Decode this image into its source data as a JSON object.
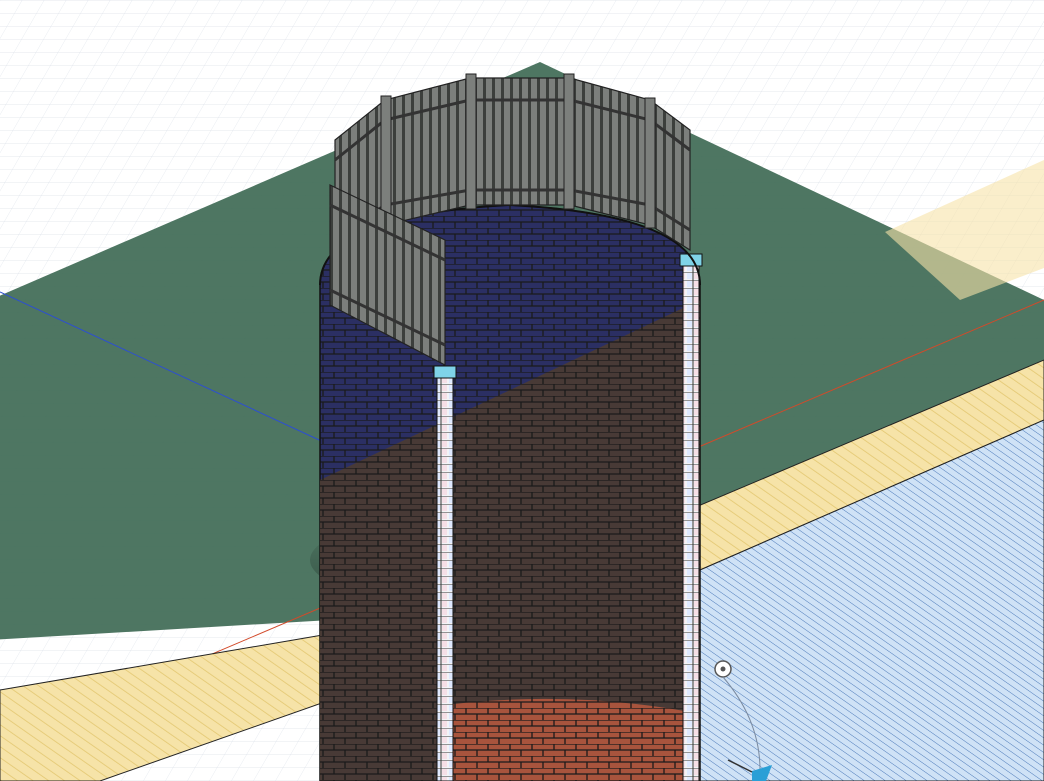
{
  "viewport": {
    "view_mode": "perspective",
    "background_color": "#ffffff",
    "grid": true
  },
  "colors": {
    "grid_minor": "#d7dde6",
    "grid_major": "#c4ccd8",
    "ground_top": "#3f6a55",
    "ground_section": "#f6e3a8",
    "ground_hatch": "#e3c770",
    "water_section": "#cfe2f6",
    "water_hatch": "#3f6fb3",
    "well_brick_upper": "#2b2f63",
    "well_brick_lower": "#4a3b34",
    "well_brick_bottom": "#a8543d",
    "mortar": "#1a1a1a",
    "fence": "#7c7f7c",
    "fence_dark": "#3c3f3c",
    "section_cap": "#7fd3e8",
    "axis_x": "#d24a2a",
    "axis_y": "#2d4fd0",
    "gizmo_accent": "#2a9fd6"
  },
  "model": {
    "objects": [
      {
        "name": "ground-slab",
        "material": "soil"
      },
      {
        "name": "water-table",
        "material": "water"
      },
      {
        "name": "brick-well",
        "material": "brick"
      },
      {
        "name": "picket-fence",
        "material": "timber"
      }
    ]
  },
  "gizmo": {
    "icons": [
      "pivot-point-icon",
      "move-arrow-icon"
    ]
  }
}
